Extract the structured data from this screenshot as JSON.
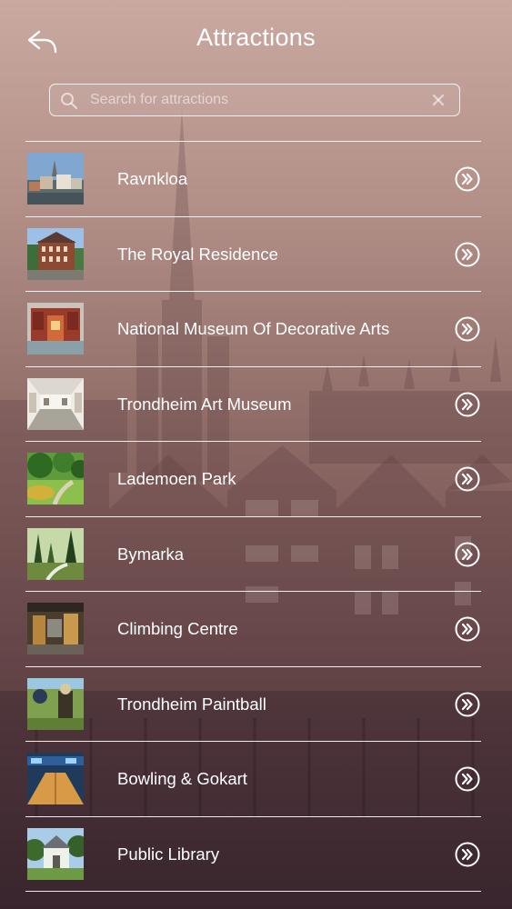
{
  "header": {
    "title": "Attractions",
    "back_icon": "back-arrow-icon"
  },
  "search": {
    "placeholder": "Search for attractions",
    "value": "",
    "search_icon": "search-icon",
    "clear_icon": "clear-icon"
  },
  "attractions": [
    {
      "label": "Ravnkloa",
      "thumb": "cityscape-photo"
    },
    {
      "label": "The Royal Residence",
      "thumb": "palace-photo"
    },
    {
      "label": "National Museum Of Decorative Arts",
      "thumb": "museum-interior-photo"
    },
    {
      "label": "Trondheim Art Museum",
      "thumb": "gallery-hall-photo"
    },
    {
      "label": "Lademoen Park",
      "thumb": "park-photo"
    },
    {
      "label": "Bymarka",
      "thumb": "forest-photo"
    },
    {
      "label": "Climbing Centre",
      "thumb": "climbing-gym-photo"
    },
    {
      "label": "Trondheim Paintball",
      "thumb": "paintball-photo"
    },
    {
      "label": "Bowling & Gokart",
      "thumb": "bowling-photo"
    },
    {
      "label": "Public Library",
      "thumb": "library-building-photo"
    }
  ],
  "row_action_icon": "chevron-double-right-circle-icon"
}
